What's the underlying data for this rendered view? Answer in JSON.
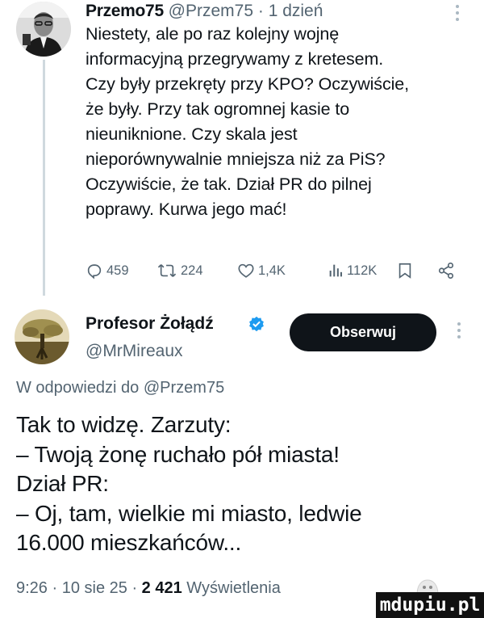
{
  "tweet1": {
    "author_name": "Przemo75",
    "author_handle": "@Przem75",
    "separator": " · ",
    "time": "1 dzień",
    "text": "Niestety, ale po raz kolejny wojnę\ninformacyjną przegrywamy z kretesem.\nCzy były przekręty przy KPO? Oczywiście,\nże były. Przy tak ogromnej kasie to\nnieuniknione. Czy skala jest\nnieporównywalnie mniejsza niż za PiS?\nOczywiście, że tak. Dział PR do pilnej\npoprawy. Kurwa jego mać!",
    "actions": {
      "replies": "459",
      "retweets": "224",
      "likes": "1,4K",
      "views": "112K"
    }
  },
  "tweet2": {
    "author_name": "Profesor Żołądź",
    "author_handle": "@MrMireaux",
    "follow_label": "Obserwuj",
    "reply_prefix": "W odpowiedzi do ",
    "reply_mention": "@Przem75",
    "text": "Tak to widzę. Zarzuty:\n– Twoją żonę ruchało pół miasta!\nDział PR:\n– Oj, tam, wielkie mi miasto, ledwie\n16.000 mieszkańców...",
    "time": "9:26",
    "separator": " · ",
    "date": "10 sie 25",
    "views_count": "2 421",
    "views_label": "Wyświetlenia"
  },
  "watermark": "mdupiu.pl",
  "colors": {
    "text": "#0f1419",
    "muted": "#536471",
    "verified": "#1d9bf0",
    "button_bg": "#0f1419"
  },
  "icons": [
    "more-icon",
    "reply-icon",
    "retweet-icon",
    "like-icon",
    "views-icon",
    "bookmark-icon",
    "share-icon",
    "verified-badge-icon"
  ]
}
